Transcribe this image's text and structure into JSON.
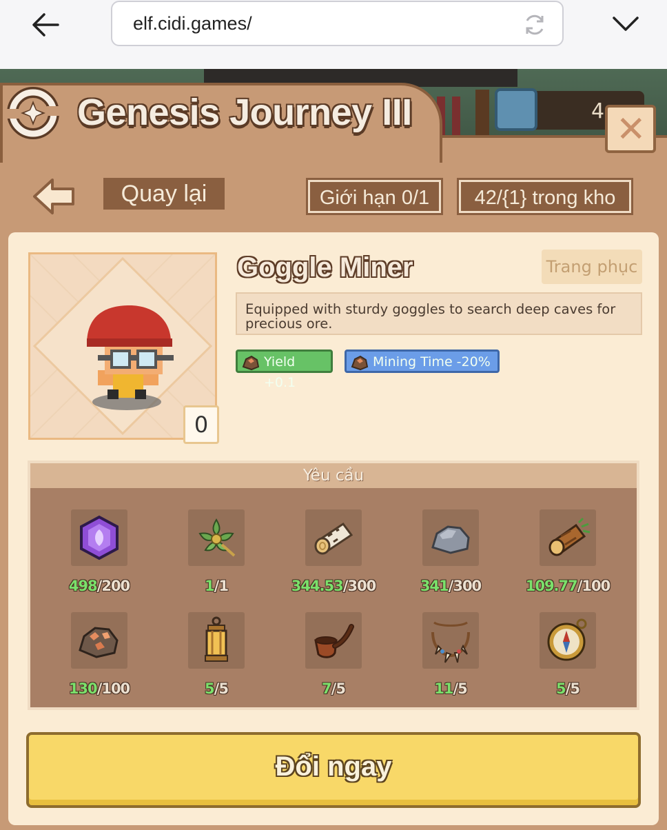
{
  "browser": {
    "url": "elf.cidi.games/"
  },
  "topbar": {
    "resource_value": "4"
  },
  "dialog": {
    "title": "Genesis Journey III",
    "back_label": "Quay lại",
    "limit_label": "Giới hạn 0/1",
    "stock_label": "42/{1} trong kho"
  },
  "item": {
    "name": "Goggle Miner",
    "category": "Trang phục",
    "description": "Equipped with sturdy goggles to search deep caves for precious ore.",
    "owned_count": "0",
    "stats": [
      {
        "label": "Yield +0.1",
        "color": "#67c266"
      },
      {
        "label": "Mining Time -20%",
        "color": "#6b9de8"
      }
    ]
  },
  "requirements": {
    "title": "Yêu cầu",
    "items": [
      {
        "icon": "purple-gem-icon",
        "have": "498",
        "need": "/200"
      },
      {
        "icon": "green-flower-icon",
        "have": "1",
        "need": "/1"
      },
      {
        "icon": "birch-log-icon",
        "have": "344.53",
        "need": "/300"
      },
      {
        "icon": "stone-icon",
        "have": "341",
        "need": "/300"
      },
      {
        "icon": "wood-log-icon",
        "have": "109.77",
        "need": "/100"
      },
      {
        "icon": "copper-ore-icon",
        "have": "130",
        "need": "/100"
      },
      {
        "icon": "lantern-icon",
        "have": "5",
        "need": "/5"
      },
      {
        "icon": "pipe-icon",
        "have": "7",
        "need": "/5"
      },
      {
        "icon": "tooth-necklace-icon",
        "have": "11",
        "need": "/5"
      },
      {
        "icon": "compass-icon",
        "have": "5",
        "need": "/5"
      }
    ]
  },
  "action": {
    "label": "Đổi ngay"
  }
}
